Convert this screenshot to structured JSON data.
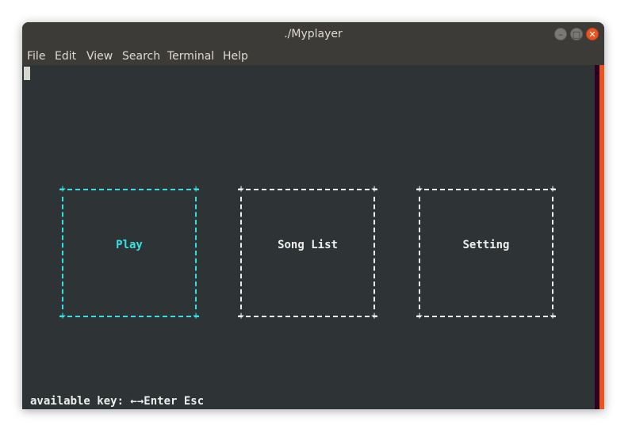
{
  "window": {
    "title": "./Myplayer",
    "controls": {
      "minimize": "–",
      "maximize": "□",
      "close": "✕"
    }
  },
  "menu": [
    {
      "label": "File"
    },
    {
      "label": "Edit"
    },
    {
      "label": "View"
    },
    {
      "label": "Search"
    },
    {
      "label": "Terminal"
    },
    {
      "label": "Help"
    }
  ],
  "terminal": {
    "options": [
      {
        "label": "Play",
        "selected": true
      },
      {
        "label": "Song List",
        "selected": false
      },
      {
        "label": "Setting",
        "selected": false
      }
    ],
    "corner_glyph": "+",
    "status_line": "available key: ←→Enter Esc"
  },
  "colors": {
    "terminal_bg": "#2e3436",
    "selected": "#34e2e2",
    "unselected": "#eeeeec",
    "accent": "#e95420"
  }
}
